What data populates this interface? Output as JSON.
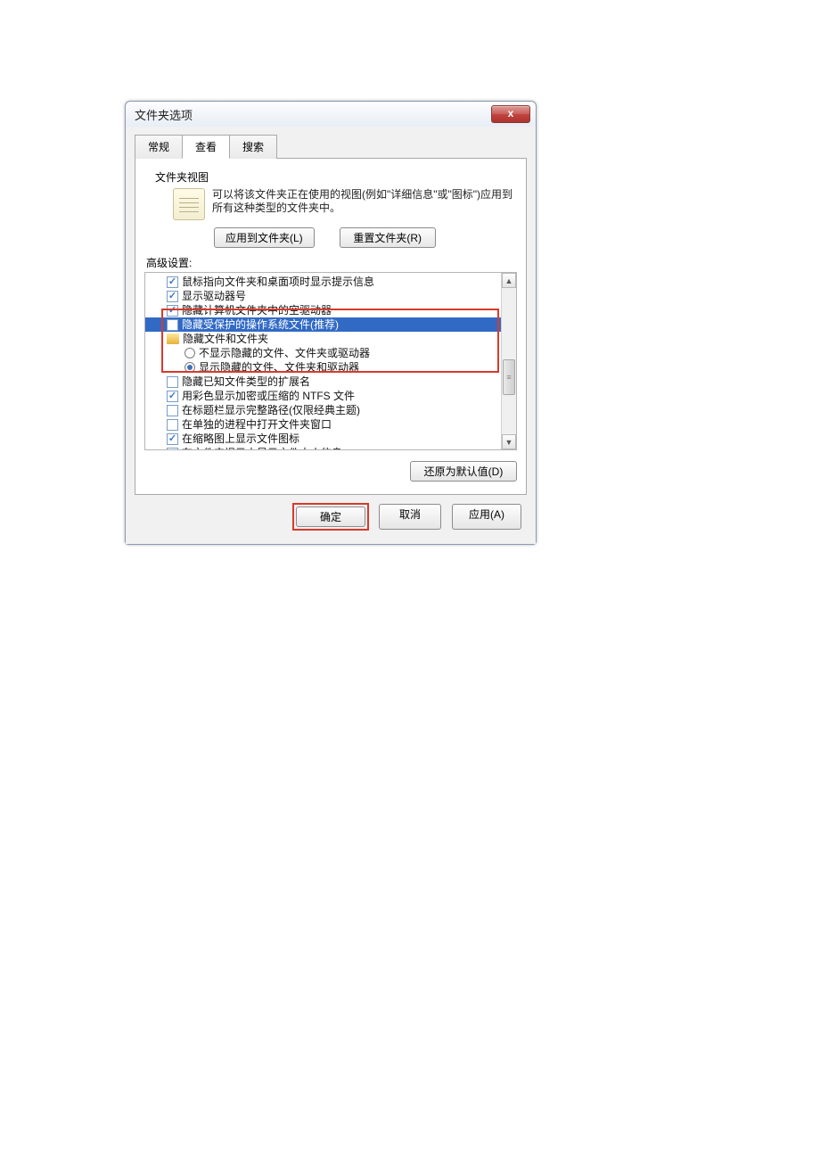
{
  "title": "文件夹选项",
  "tabs": {
    "general": "常规",
    "view": "查看",
    "search": "搜索"
  },
  "folderview": {
    "label": "文件夹视图",
    "desc": "可以将该文件夹正在使用的视图(例如\"详细信息\"或\"图标\")应用到所有这种类型的文件夹中。",
    "apply_btn": "应用到文件夹(L)",
    "reset_btn": "重置文件夹(R)"
  },
  "adv": {
    "label": "高级设置:",
    "items": [
      {
        "type": "chk",
        "checked": true,
        "text": "鼠标指向文件夹和桌面项时显示提示信息"
      },
      {
        "type": "chk",
        "checked": true,
        "text": "显示驱动器号"
      },
      {
        "type": "chk",
        "checked": true,
        "text": "隐藏计算机文件夹中的空驱动器"
      },
      {
        "type": "chk",
        "checked": false,
        "text": "隐藏受保护的操作系统文件(推荐)",
        "highlight": true
      },
      {
        "type": "folder",
        "text": "隐藏文件和文件夹"
      },
      {
        "type": "radio",
        "checked": false,
        "sub": true,
        "text": "不显示隐藏的文件、文件夹或驱动器"
      },
      {
        "type": "radio",
        "checked": true,
        "sub": true,
        "text": "显示隐藏的文件、文件夹和驱动器"
      },
      {
        "type": "chk",
        "checked": false,
        "text": "隐藏已知文件类型的扩展名"
      },
      {
        "type": "chk",
        "checked": true,
        "text": "用彩色显示加密或压缩的 NTFS 文件"
      },
      {
        "type": "chk",
        "checked": false,
        "text": "在标题栏显示完整路径(仅限经典主题)"
      },
      {
        "type": "chk",
        "checked": false,
        "text": "在单独的进程中打开文件夹窗口"
      },
      {
        "type": "chk",
        "checked": true,
        "text": "在缩略图上显示文件图标"
      },
      {
        "type": "chk",
        "checked": true,
        "text": "在文件夹提示中显示文件大小信息"
      }
    ],
    "restore_btn": "还原为默认值(D)"
  },
  "buttons": {
    "ok": "确定",
    "cancel": "取消",
    "apply": "应用(A)"
  }
}
